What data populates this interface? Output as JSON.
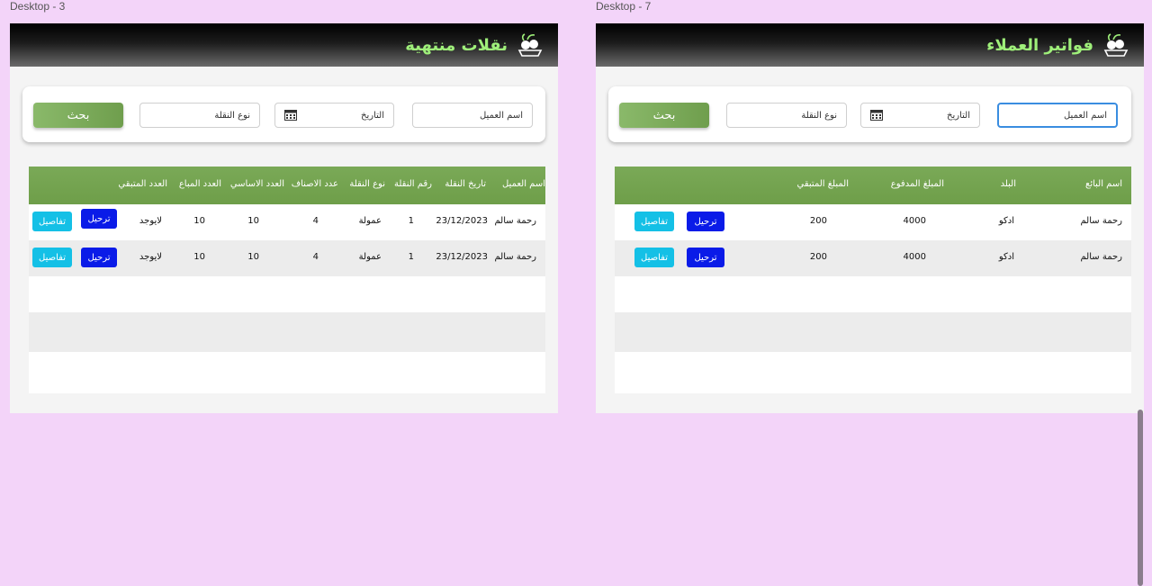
{
  "frames": {
    "left": {
      "label": "Desktop - 3",
      "title": "نقلات منتهية",
      "search": {
        "client_placeholder": "اسم العميل",
        "date_placeholder": "التاريخ",
        "type_placeholder": "نوع النقلة",
        "button_label": "بحث"
      },
      "headers": [
        "اسم العميل",
        "تاريخ النقلة",
        "رقم النقلة",
        "نوع النقلة",
        "عدد الاصناف",
        "العدد الاساسي",
        "العدد المباع",
        "العدد المتبقي"
      ],
      "rows": [
        {
          "client": "رحمة سالم",
          "date": "23/12/2023",
          "num": "1",
          "type": "عمولة",
          "items": "4",
          "base": "10",
          "sold": "10",
          "remaining": "لايوجد",
          "post": "ترحيل",
          "details": "تفاصيل"
        },
        {
          "client": "رحمة سالم",
          "date": "23/12/2023",
          "num": "1",
          "type": "عمولة",
          "items": "4",
          "base": "10",
          "sold": "10",
          "remaining": "لايوجد",
          "post": "ترحيل",
          "details": "تفاصيل"
        }
      ]
    },
    "right": {
      "label": "Desktop - 7",
      "title": "فواتير العملاء",
      "search": {
        "client_placeholder": "اسم العميل",
        "date_placeholder": "التاريخ",
        "type_placeholder": "نوع النقلة",
        "button_label": "بحث"
      },
      "headers": [
        "اسم البائع",
        "البلد",
        "المبلغ المدفوع",
        "المبلغ المتبقي"
      ],
      "rows": [
        {
          "seller": "رحمة سالم",
          "country": "ادكو",
          "paid": "4000",
          "remaining": "200",
          "post": "ترحيل",
          "details": "تفاصيل"
        },
        {
          "seller": "رحمة سالم",
          "country": "ادكو",
          "paid": "4000",
          "remaining": "200",
          "post": "ترحيل",
          "details": "تفاصيل"
        }
      ]
    }
  },
  "colors": {
    "canvas": "#f3d4f9",
    "accent_green": "#7aa957",
    "title_green": "#9ff07a",
    "button_blue": "#0a1be8",
    "button_cyan": "#14c0e6"
  }
}
